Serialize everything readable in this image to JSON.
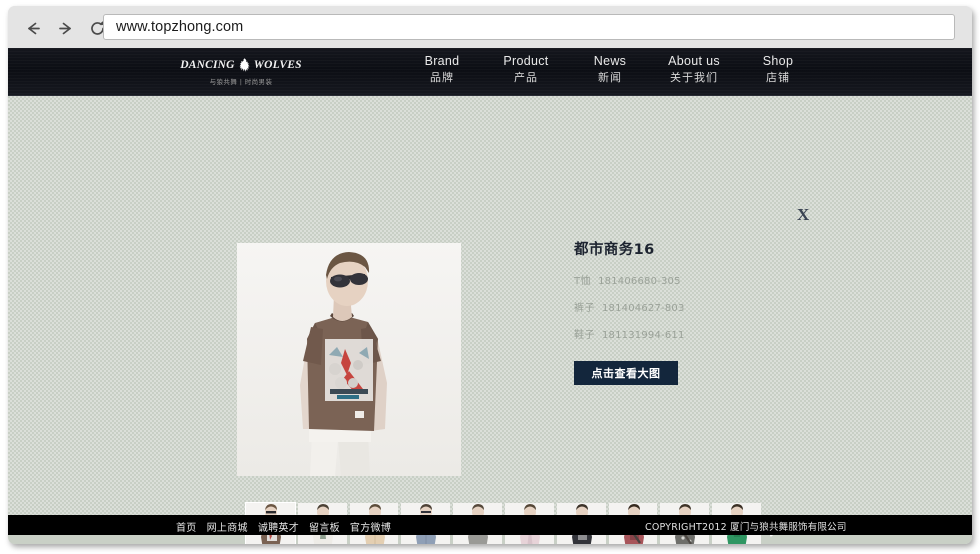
{
  "browser": {
    "back_label": "back-arrow",
    "forward_label": "forward-arrow",
    "reload_label": "reload",
    "url": "www.topzhong.com"
  },
  "site": {
    "logo": {
      "word_left": "DANCING",
      "word_right": "WOLVES",
      "mark": "wolf-icon",
      "subtitle": "与狼共舞 | 时尚男装"
    },
    "nav": [
      {
        "en": "Brand",
        "cn": "品牌"
      },
      {
        "en": "Product",
        "cn": "产品"
      },
      {
        "en": "News",
        "cn": "新闻"
      },
      {
        "en": "About us",
        "cn": "关于我们"
      },
      {
        "en": "Shop",
        "cn": "店铺"
      }
    ]
  },
  "overlay": {
    "close_label": "X"
  },
  "product": {
    "title": "都市商务16",
    "specs": [
      {
        "label": "T恤",
        "code": "181406680-305"
      },
      {
        "label": "裤子",
        "code": "181404627-803"
      },
      {
        "label": "鞋子",
        "code": "181131994-611"
      }
    ],
    "view_large_button": "点击查看大图"
  },
  "gallery": {
    "next_label": "next-arrow",
    "thumbs": [
      {
        "alt": "brown-graphic-tee",
        "shirt": "#7a6253",
        "pants": "#efece6",
        "active": true
      },
      {
        "alt": "white-print-tee",
        "shirt": "#eeece7",
        "pants": "#b9c9b6",
        "active": false
      },
      {
        "alt": "beige-shirt",
        "shirt": "#e4cfb2",
        "pants": "#f0efe9",
        "active": false
      },
      {
        "alt": "blue-chambray-shirt",
        "shirt": "#8f9fb6",
        "pants": "#f1efe9",
        "active": false
      },
      {
        "alt": "gray-tee",
        "shirt": "#9a9a96",
        "pants": "#f0eee8",
        "active": false
      },
      {
        "alt": "pink-light-shirt",
        "shirt": "#e7d3d8",
        "pants": "#f1efe9",
        "active": false
      },
      {
        "alt": "black-print-tee",
        "shirt": "#33343a",
        "pants": "#4c5564",
        "active": false
      },
      {
        "alt": "red-print-tee",
        "shirt": "#a8555a",
        "pants": "#d6cd5e",
        "active": false
      },
      {
        "alt": "patterned-shirt",
        "shirt": "#6e6e6a",
        "pants": "#f1efe9",
        "active": false
      },
      {
        "alt": "green-tee",
        "shirt": "#2f9662",
        "pants": "#f1efe9",
        "active": false
      }
    ]
  },
  "footer": {
    "links": [
      "首页",
      "网上商城",
      "诚聘英才",
      "留言板",
      "官方微博"
    ],
    "copyright": "COPYRIGHT2012 厦门与狼共舞服饰有限公司"
  },
  "colors": {
    "header_bg": "#0c0e14",
    "page_bg": "#c8cfc5",
    "button_navy": "#13263c",
    "footer_bg": "#000000"
  }
}
